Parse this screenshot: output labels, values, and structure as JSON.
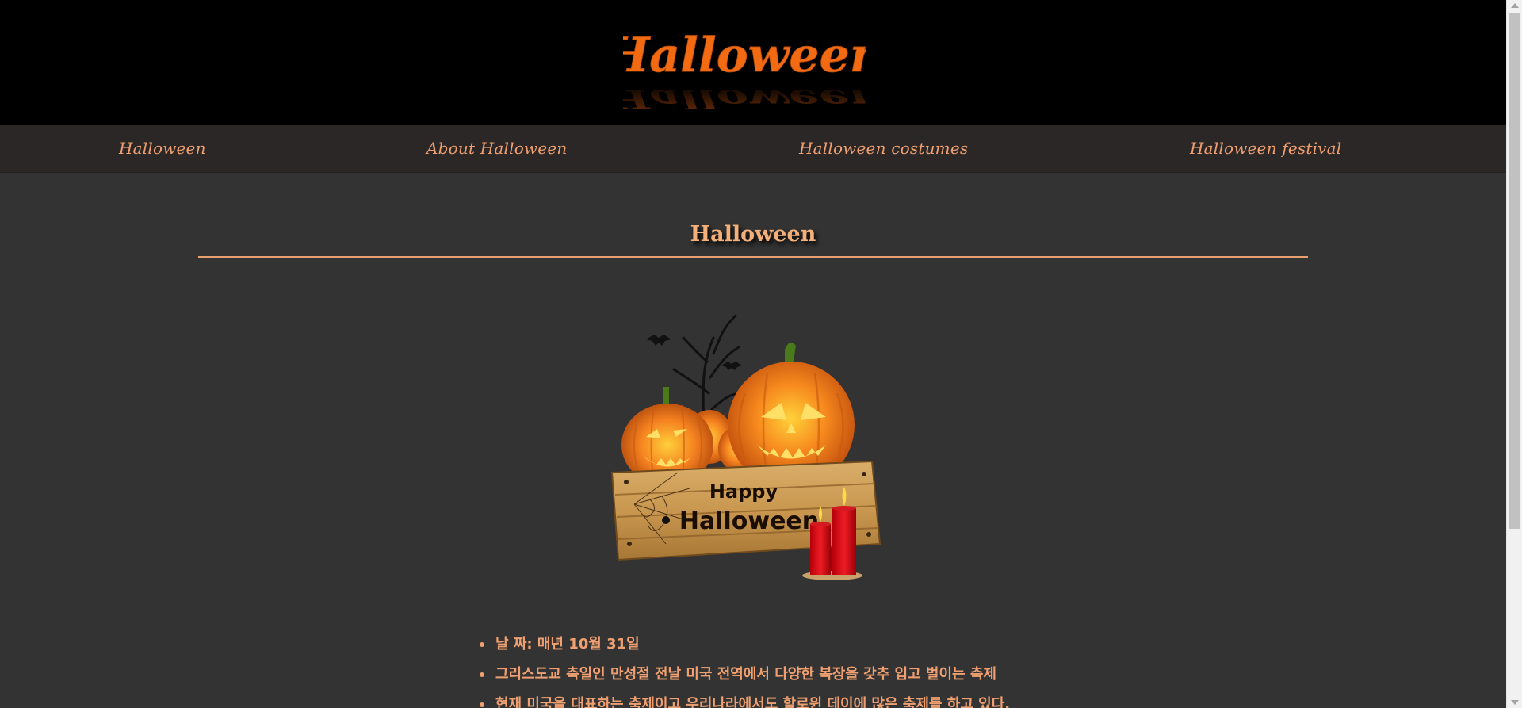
{
  "header": {
    "logo_text": "Halloween"
  },
  "nav": {
    "items": [
      {
        "label": "Halloween"
      },
      {
        "label": "About Halloween"
      },
      {
        "label": "Halloween costumes"
      },
      {
        "label": "Halloween festival"
      }
    ]
  },
  "main": {
    "title": "Halloween",
    "image": {
      "sign_top": "Happy",
      "sign_bottom": "Halloween"
    },
    "facts": [
      "날 짜: 매년 10월 31일",
      "그리스도교 축일인 만성절 전날 미국 전역에서 다양한 복장을 갖추 입고 벌이는 축제",
      "현재 미국을 대표하는 축제이고 우리나라에서도 할로윈 데이에 많은 축제를 하고 있다."
    ]
  },
  "colors": {
    "accent": "#f0a070",
    "banner_bg": "#000000",
    "nav_bg": "#2c2727",
    "page_bg": "#333333",
    "logo": "#f26b12"
  }
}
